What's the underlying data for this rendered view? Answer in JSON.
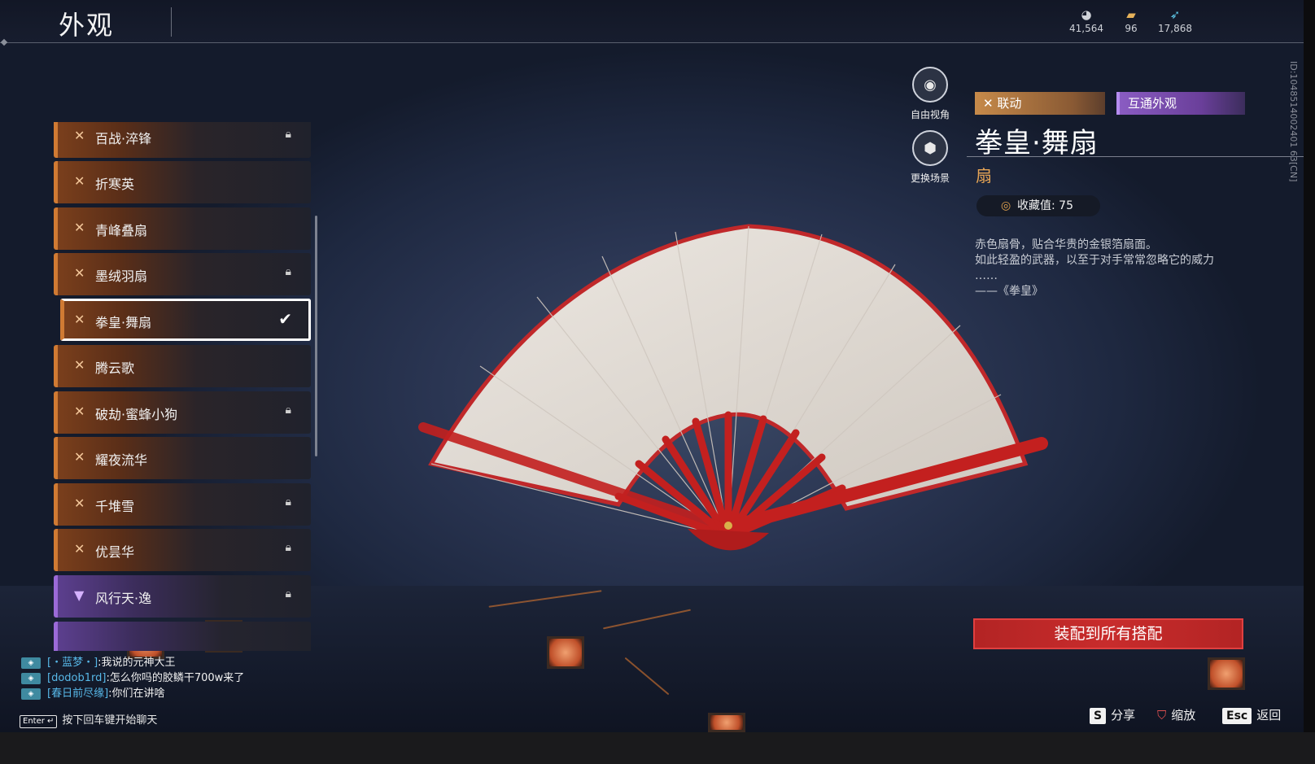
{
  "header": {
    "title": "外观",
    "currencies": [
      {
        "icon": "jade-icon",
        "value": "41,564"
      },
      {
        "icon": "ticket-icon",
        "value": "96"
      },
      {
        "icon": "feather-icon",
        "value": "17,868"
      }
    ]
  },
  "list": {
    "items": [
      {
        "label": "百战·淬锋",
        "locked": true,
        "style": "orange"
      },
      {
        "label": "折寒英",
        "locked": false,
        "style": "orange"
      },
      {
        "label": "青峰叠扇",
        "locked": false,
        "style": "orange"
      },
      {
        "label": "墨绒羽扇",
        "locked": true,
        "style": "orange"
      },
      {
        "label": "拳皇·舞扇",
        "locked": false,
        "style": "orange",
        "selected": true
      },
      {
        "label": "腾云歌",
        "locked": false,
        "style": "orange"
      },
      {
        "label": "破劫·蜜蜂小狗",
        "locked": true,
        "style": "orange"
      },
      {
        "label": "耀夜流华",
        "locked": false,
        "style": "orange"
      },
      {
        "label": "千堆雪",
        "locked": true,
        "style": "orange"
      },
      {
        "label": "优昙华",
        "locked": true,
        "style": "orange"
      },
      {
        "label": "风行天·逸",
        "locked": true,
        "style": "purple"
      }
    ]
  },
  "view_buttons": {
    "free_camera": "自由视角",
    "change_scene": "更换场景"
  },
  "detail": {
    "tag_collab": "联动",
    "tag_shared": "互通外观",
    "name": "拳皇·舞扇",
    "type": "扇",
    "collection_label": "收藏值: 75",
    "description": [
      "赤色扇骨，贴合华贵的金银箔扇面。",
      "如此轻盈的武器，以至于对手常常忽略它的威力",
      "……",
      "——《拳皇》"
    ],
    "equip_button": "装配到所有搭配",
    "vertical_id": "ID:1048514002401 63[CN]"
  },
  "chat": {
    "messages": [
      {
        "who": "[・蓝梦・]",
        "msg": ":我说的元神大王"
      },
      {
        "who": "[dodob1rd]",
        "msg": ":怎么你吗的胶鳞干700w来了"
      },
      {
        "who": "[春日前尽缘]",
        "msg": ":你们在讲啥"
      }
    ],
    "enter_key": "Enter ↵",
    "enter_hint": "按下回车键开始聊天"
  },
  "hotkeys": {
    "share_key": "S",
    "share_label": "分享",
    "zoom_label": "缩放",
    "back_key": "Esc",
    "back_label": "返回"
  }
}
